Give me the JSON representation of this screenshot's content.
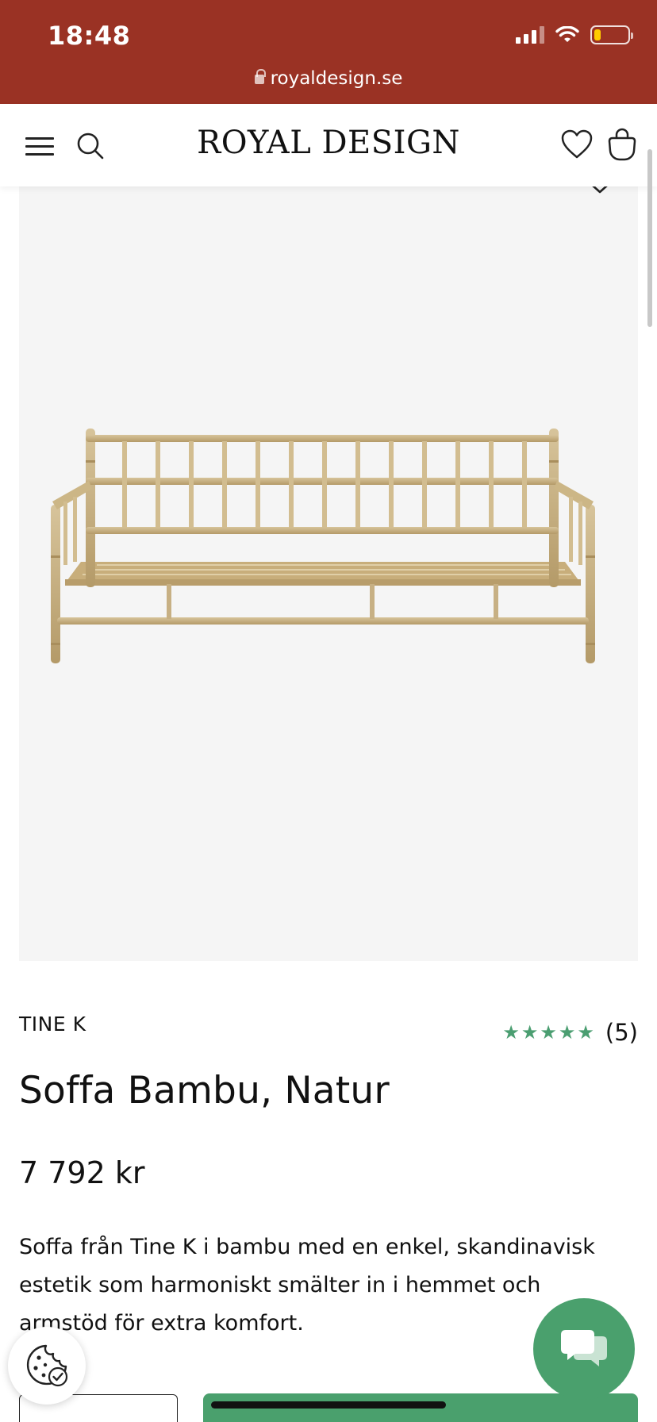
{
  "status_bar": {
    "time": "18:48",
    "url": "royaldesign.se",
    "icons": [
      "signal-icon",
      "wifi-icon",
      "battery-low-icon",
      "lock-icon"
    ],
    "battery_level": 0.2,
    "battery_color": "#ffcc00",
    "background_color": "#9a3224"
  },
  "header": {
    "logo": "ROYAL DESIGN",
    "icons": [
      "menu-icon",
      "search-icon",
      "heart-icon",
      "shopping-bag-icon"
    ]
  },
  "product": {
    "image_icon": "chevron-down-icon",
    "image_alt": "sofa-image",
    "brand": "TINE K",
    "rating": {
      "stars": 5,
      "star_glyph": "★",
      "count": "(5)",
      "star_color": "#4b9e71"
    },
    "title": "Soffa Bambu, Natur",
    "price": "7 792 kr",
    "description": "Soffa från Tine K i bambu med en enkel, skandinavisk estetik som harmoniskt smälter in i hemmet och armstöd för extra komfort."
  },
  "floating": {
    "cookie_icon": "cookie-consent-icon",
    "chat_icon": "chat-icon",
    "accent_color": "#4aa06d"
  }
}
